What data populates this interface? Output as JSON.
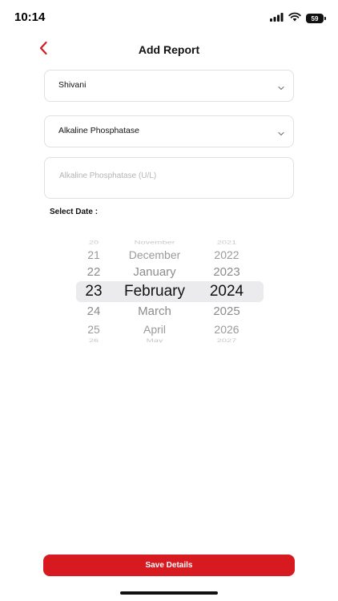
{
  "status_bar": {
    "time": "10:14",
    "battery": "59"
  },
  "header": {
    "title": "Add Report",
    "back_icon": "chevron-left-icon",
    "accent_color": "#d71920"
  },
  "form": {
    "member_select": {
      "value": "Shivani"
    },
    "test_select": {
      "value": "Alkaline Phosphatase"
    },
    "result_input": {
      "value": "",
      "placeholder": "Alkaline Phosphatase (U/L)"
    },
    "date_label": "Select Date :"
  },
  "date_picker": {
    "day": {
      "far_above": "20",
      "above2": "21",
      "above1": "22",
      "selected": "23",
      "below1": "24",
      "below2": "25",
      "far_below": "26"
    },
    "month": {
      "far_above": "November",
      "above2": "December",
      "above1": "January",
      "selected": "February",
      "below1": "March",
      "below2": "April",
      "far_below": "May"
    },
    "year": {
      "far_above": "2021",
      "above2": "2022",
      "above1": "2023",
      "selected": "2024",
      "below1": "2025",
      "below2": "2026",
      "far_below": "2027"
    }
  },
  "actions": {
    "save_label": "Save Details",
    "save_color": "#d71920"
  }
}
